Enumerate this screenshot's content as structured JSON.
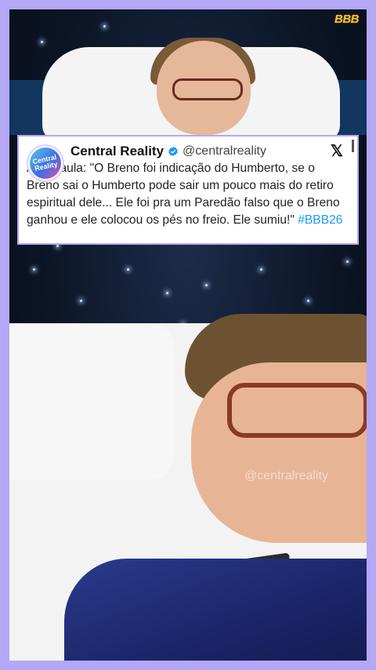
{
  "logo": "BBB",
  "tweet": {
    "name": "Central Reality",
    "handle": "@centralreality",
    "avatar_text": "Central Reality",
    "text": "Ana Paula: \"O Breno foi indicação do Humberto, se o Breno sai o Humberto pode sair um pouco mais do retiro espiritual dele... Ele foi pra um Paredão falso que o Breno ganhou e ele colocou os pés no freio. Ele sumiu!\" ",
    "hashtag": "#BBB26",
    "x_logo": "𝕏",
    "verified_color": "#1d9bf0"
  },
  "watermark": "@centralreality",
  "colors": {
    "frame": "#b4a7f5",
    "link": "#1d9bf0"
  }
}
